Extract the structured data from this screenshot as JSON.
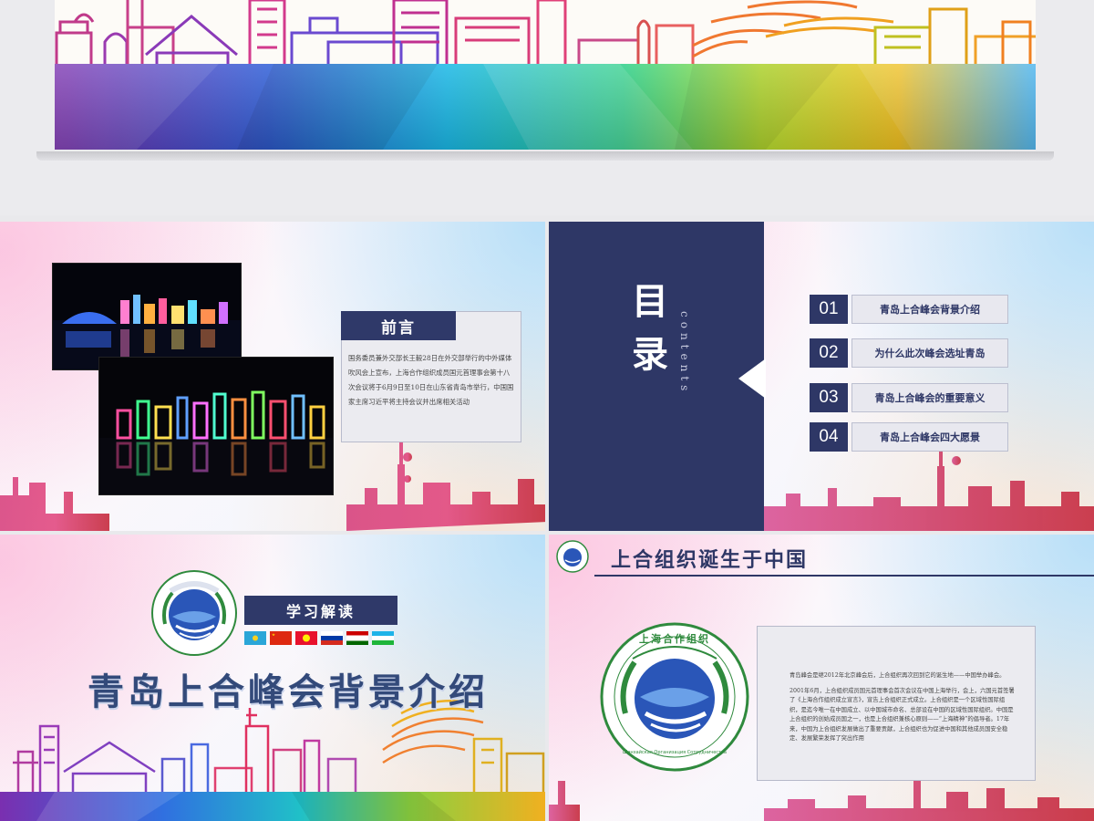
{
  "colors": {
    "navy": "#2e3766",
    "panel_gray": "#ebebf0",
    "logo_green": "#2f8a3d",
    "logo_blue": "#1d3f8f"
  },
  "slide_intro": {
    "title": "前言",
    "body": "国务委员兼外交部长王毅28日在外交部举行的中外媒体吹风会上宣布，上海合作组织成员国元首理事会第十八次会议将于6月9日至10日在山东省青岛市举行，中国国家主席习近平将主持会议并出席相关活动"
  },
  "slide_toc": {
    "title": "目录",
    "subtitle": "contents",
    "items": [
      {
        "num": "01",
        "label": "青岛上合峰会背景介绍"
      },
      {
        "num": "02",
        "label": "为什么此次峰会选址青岛"
      },
      {
        "num": "03",
        "label": "青岛上合峰会的重要意义"
      },
      {
        "num": "04",
        "label": "青岛上合峰会四大愿景"
      }
    ]
  },
  "slide_section": {
    "tag": "学习解读",
    "title": "青岛上合峰会背景介绍",
    "flags": [
      "kazakhstan-flag",
      "china-flag",
      "kyrgyzstan-flag",
      "russia-flag",
      "tajikistan-flag",
      "uzbekistan-flag"
    ]
  },
  "slide_birth": {
    "title": "上合组织诞生于中国",
    "paragraphs": [
      "青岛峰会是继2012年北京峰会后，上合组织再次回到它的诞生地——中国举办峰会。",
      "2001年6月，上合组织成员国元首理事会首次会议在中国上海举行，会上，六国元首签署了《上海合作组织成立宣言》，宣告上合组织正式成立。上合组织是一个区域性国际组织，是迄今唯一在中国成立、以中国城市命名、总部设在中国的区域性国际组织。中国是上合组织的创始成员国之一，也是上合组织兼核心原则——“上海精神”的倡导者。17年来，中国为上合组织发展做出了重要贡献，上合组织也为促进中国和其他成员国安全稳定、发展繁荣发挥了突出作用"
    ]
  },
  "logo": {
    "text_top": "上海合作组织",
    "text_bottom": "Шанхайская Организация Сотрудничества"
  }
}
